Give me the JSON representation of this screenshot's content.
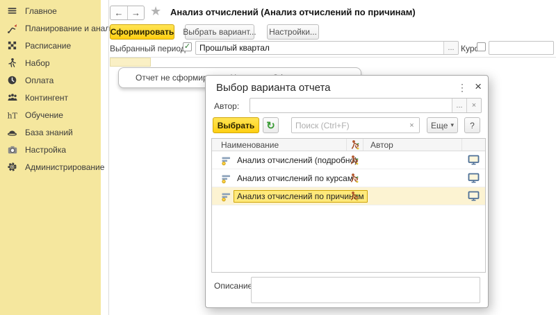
{
  "sidebar": {
    "items": [
      {
        "label": "Главное",
        "icon": "menu-icon"
      },
      {
        "label": "Планирование и анализ",
        "icon": "planning-chart-icon"
      },
      {
        "label": "Расписание",
        "icon": "schedule-grid-icon"
      },
      {
        "label": "Набор",
        "icon": "recruitment-person-icon"
      },
      {
        "label": "Оплата",
        "icon": "payment-icon"
      },
      {
        "label": "Контингент",
        "icon": "contingent-people-icon"
      },
      {
        "label": "Обучение",
        "icon": "training-icon"
      },
      {
        "label": "База знаний",
        "icon": "knowledge-base-icon"
      },
      {
        "label": "Настройка",
        "icon": "setup-camera-icon"
      },
      {
        "label": "Администрирование",
        "icon": "administration-gear-icon"
      }
    ]
  },
  "header": {
    "back": "←",
    "forward": "→",
    "star": "★",
    "title": "Анализ отчислений (Анализ отчислений по причинам)"
  },
  "toolbar": {
    "generate": "Сформировать",
    "choose_variant": "Выбрать вариант...",
    "settings": "Настройки..."
  },
  "period": {
    "label": "Выбранный период:",
    "checked": true,
    "check_glyph": "✓",
    "value": "Прошлый квартал",
    "ellipsis": "...",
    "course_label": "Курс:"
  },
  "report": {
    "message": "Отчет не сформирован. Нажмите «Сформировать» для получения отчета."
  },
  "dialog": {
    "title": "Выбор варианта отчета",
    "menu_glyph": "⋮",
    "close_glyph": "×",
    "author_label": "Автор:",
    "author_ellipsis": "...",
    "author_clear": "×",
    "select_button": "Выбрать",
    "refresh_glyph": "↻",
    "search_placeholder": "Поиск (Ctrl+F)",
    "search_clear": "×",
    "more_button": "Еще",
    "more_arrow": "▾",
    "help_button": "?",
    "table": {
      "columns": [
        "Наименование",
        "Автор"
      ],
      "rows": [
        {
          "name": "Анализ отчислений (подробно)",
          "selected": false
        },
        {
          "name": "Анализ отчислений по курсам",
          "selected": false
        },
        {
          "name": "Анализ отчислений по причинам",
          "selected": true
        }
      ]
    },
    "description_label": "Описание:"
  },
  "colors": {
    "sidebar_bg": "#f5e79e",
    "accent_yellow": "#ffd012",
    "selected_row_bg": "#fcf3d2",
    "selected_cell_bg": "#ffe97b",
    "selected_cell_border": "#cfa403"
  }
}
